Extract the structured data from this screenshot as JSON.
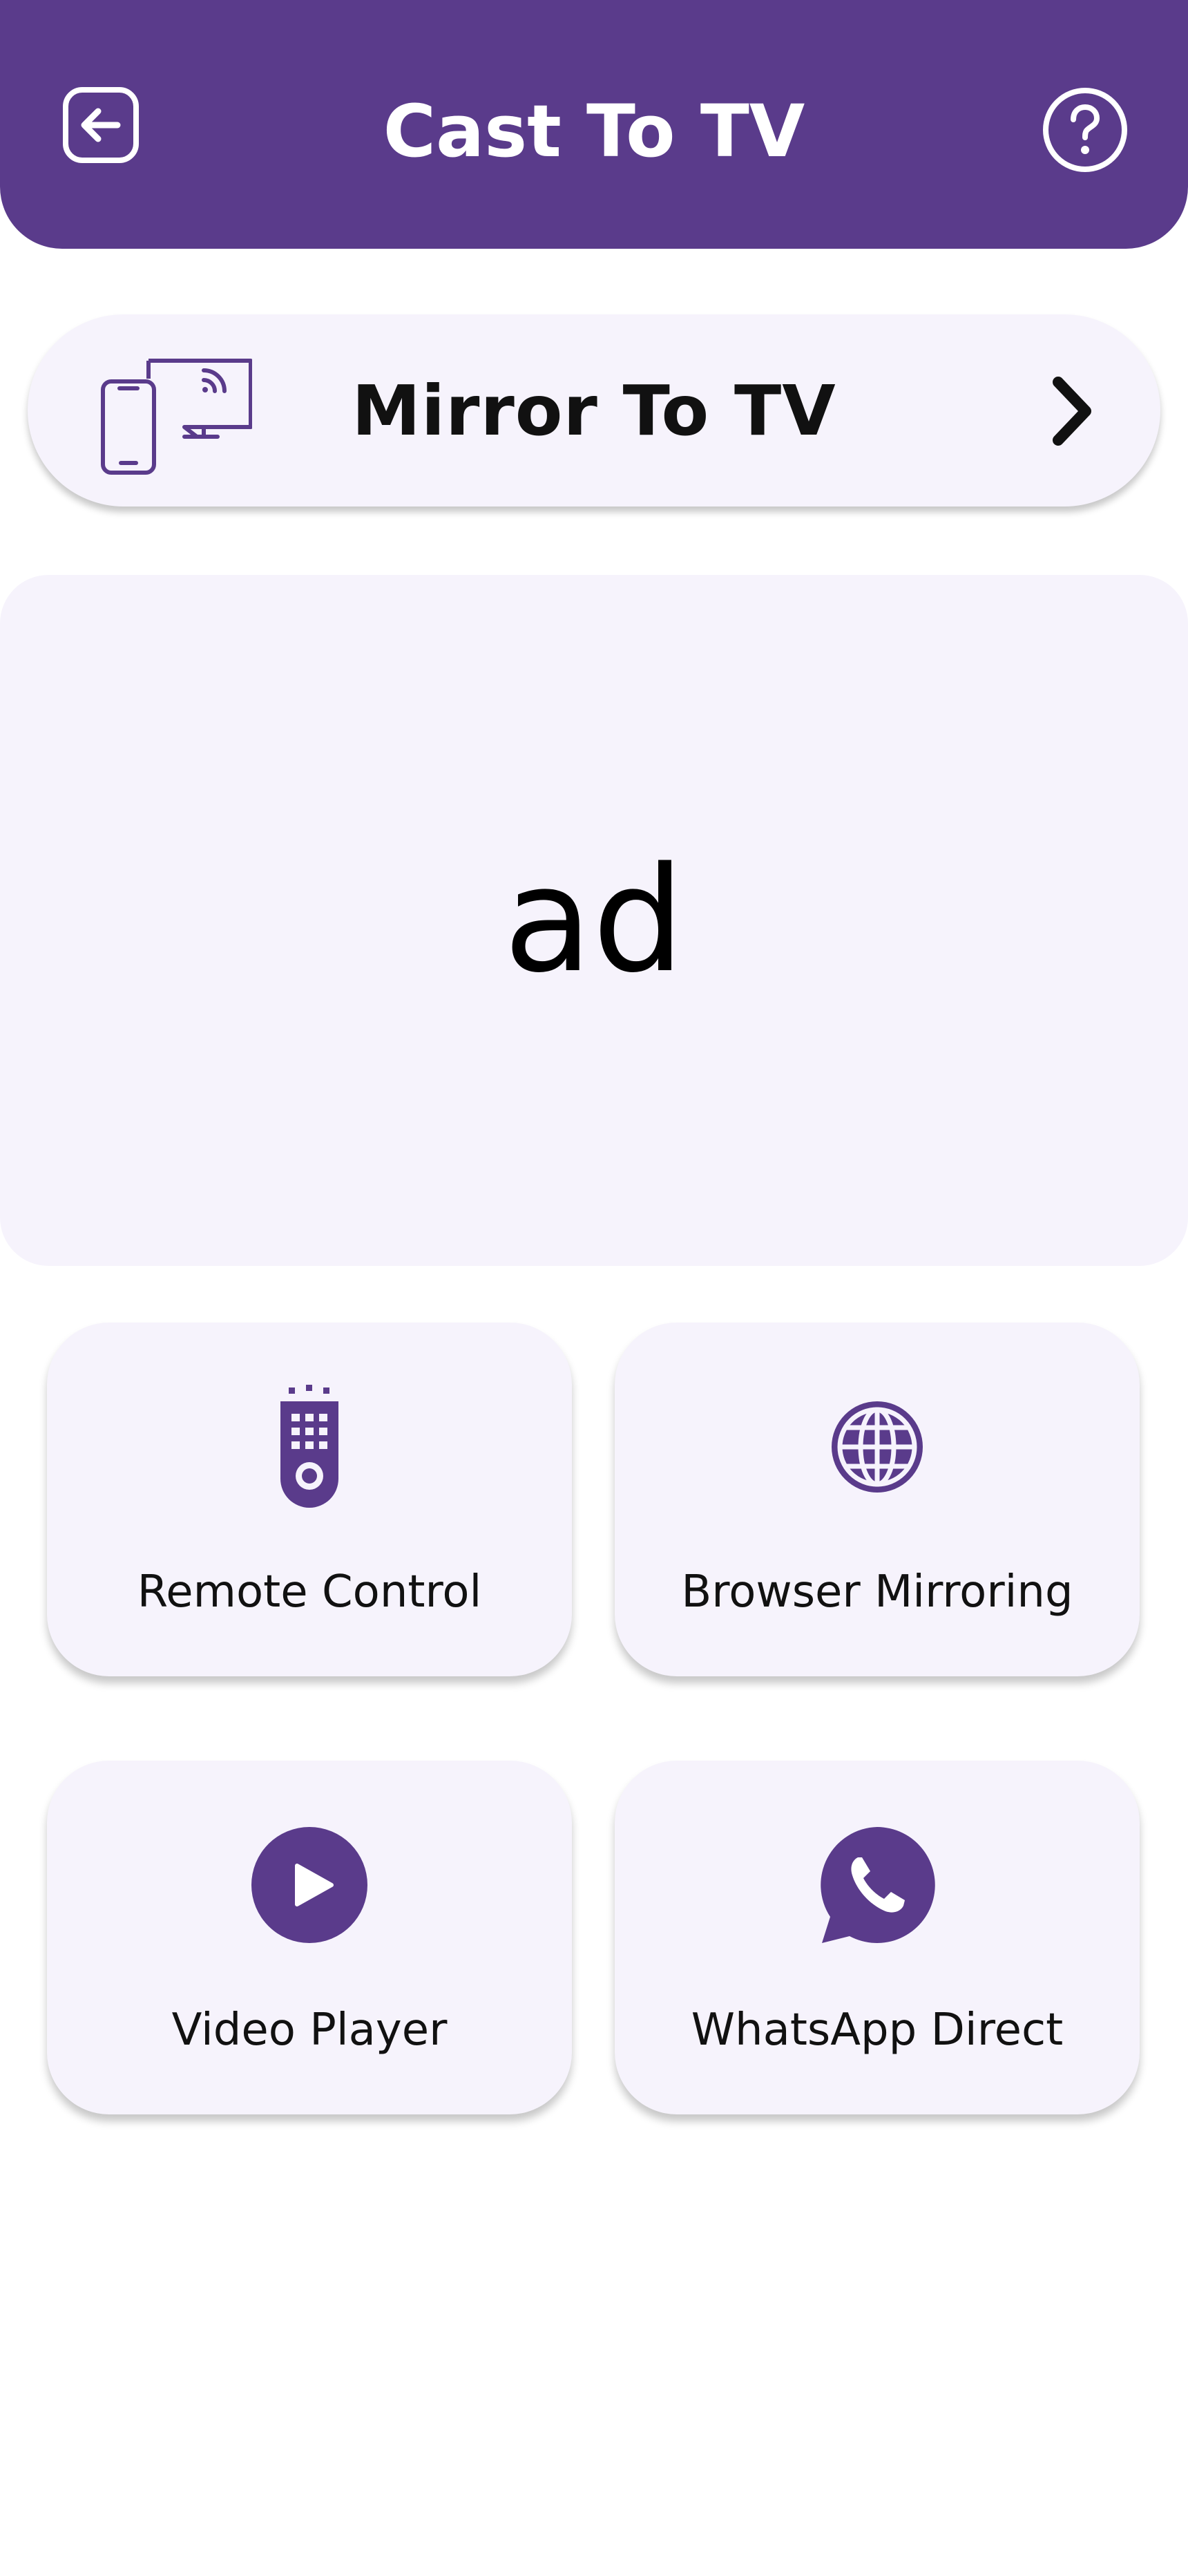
{
  "colors": {
    "brand_purple": "#5a3b8b",
    "card_background": "#f6f3fc",
    "header_text": "#ffffff",
    "body_text": "#111111"
  },
  "header": {
    "title": "Cast To TV",
    "back_icon": "back-arrow-icon",
    "help_icon": "help-icon"
  },
  "mirror": {
    "label": "Mirror To TV",
    "icon": "phone-cast-tv-icon",
    "chevron_icon": "chevron-right-icon"
  },
  "ad": {
    "text": "ad"
  },
  "features": [
    {
      "label": "Remote Control",
      "icon": "remote-control-icon"
    },
    {
      "label": "Browser Mirroring",
      "icon": "globe-icon"
    },
    {
      "label": "Video Player",
      "icon": "play-icon"
    },
    {
      "label": "WhatsApp Direct",
      "icon": "whatsapp-icon"
    }
  ]
}
